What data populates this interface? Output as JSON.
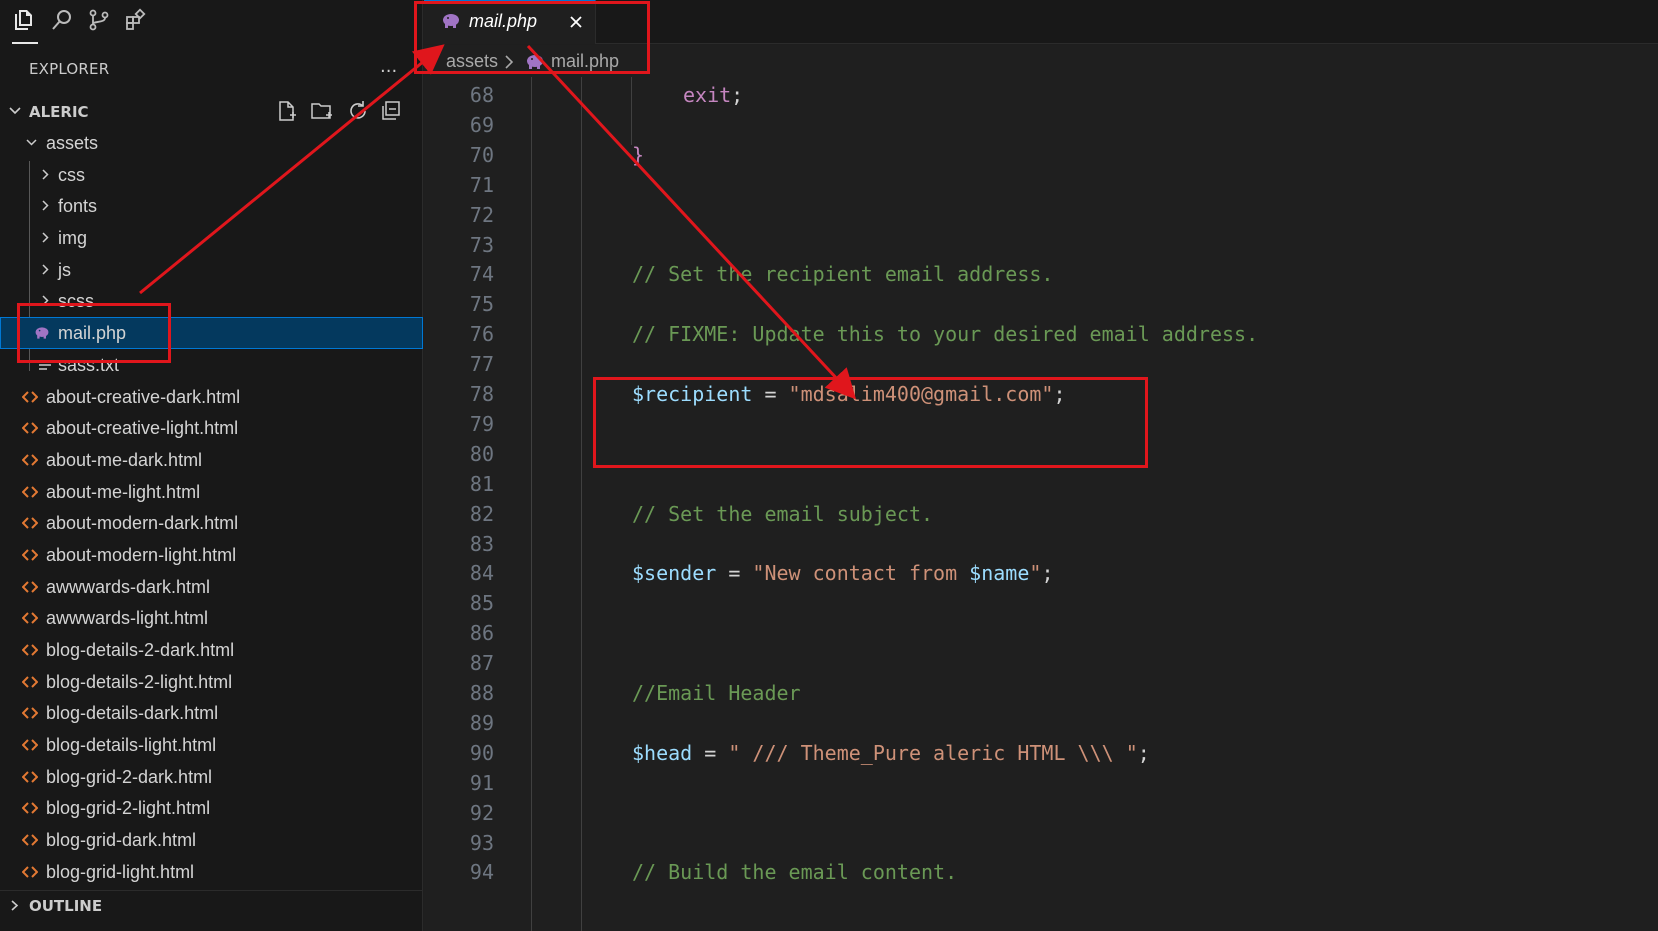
{
  "sidebar": {
    "title": "EXPLORER",
    "more": "...",
    "root": "ALERIC",
    "items": [
      {
        "label": "assets",
        "kind": "folder-open",
        "depth": 1
      },
      {
        "label": "css",
        "kind": "folder",
        "depth": 2
      },
      {
        "label": "fonts",
        "kind": "folder",
        "depth": 2
      },
      {
        "label": "img",
        "kind": "folder",
        "depth": 2
      },
      {
        "label": "js",
        "kind": "folder",
        "depth": 2
      },
      {
        "label": "scss",
        "kind": "folder",
        "depth": 2
      },
      {
        "label": "mail.php",
        "kind": "php",
        "depth": 2,
        "selected": true
      },
      {
        "label": "sass.txt",
        "kind": "txt",
        "depth": 2
      },
      {
        "label": "about-creative-dark.html",
        "kind": "html",
        "depth": 1
      },
      {
        "label": "about-creative-light.html",
        "kind": "html",
        "depth": 1
      },
      {
        "label": "about-me-dark.html",
        "kind": "html",
        "depth": 1
      },
      {
        "label": "about-me-light.html",
        "kind": "html",
        "depth": 1
      },
      {
        "label": "about-modern-dark.html",
        "kind": "html",
        "depth": 1
      },
      {
        "label": "about-modern-light.html",
        "kind": "html",
        "depth": 1
      },
      {
        "label": "awwwards-dark.html",
        "kind": "html",
        "depth": 1
      },
      {
        "label": "awwwards-light.html",
        "kind": "html",
        "depth": 1
      },
      {
        "label": "blog-details-2-dark.html",
        "kind": "html",
        "depth": 1
      },
      {
        "label": "blog-details-2-light.html",
        "kind": "html",
        "depth": 1
      },
      {
        "label": "blog-details-dark.html",
        "kind": "html",
        "depth": 1
      },
      {
        "label": "blog-details-light.html",
        "kind": "html",
        "depth": 1
      },
      {
        "label": "blog-grid-2-dark.html",
        "kind": "html",
        "depth": 1
      },
      {
        "label": "blog-grid-2-light.html",
        "kind": "html",
        "depth": 1
      },
      {
        "label": "blog-grid-dark.html",
        "kind": "html",
        "depth": 1
      },
      {
        "label": "blog-grid-light.html",
        "kind": "html",
        "depth": 1
      }
    ],
    "outline": "OUTLINE"
  },
  "tab": {
    "label": "mail.php",
    "icon": "php-elephant-icon"
  },
  "breadcrumb": {
    "folder": "assets",
    "file": "mail.php"
  },
  "editor": {
    "lines": [
      {
        "n": "68",
        "tokens": [
          {
            "t": "exit",
            "c": "kw"
          },
          {
            "t": ";",
            "c": "op"
          }
        ],
        "indent": 2
      },
      {
        "n": "69",
        "tokens": [],
        "indent": 0
      },
      {
        "n": "70",
        "tokens": [
          {
            "t": "}",
            "c": "kw"
          }
        ],
        "indent": 1
      },
      {
        "n": "71",
        "tokens": [],
        "indent": 0
      },
      {
        "n": "72",
        "tokens": [],
        "indent": 0
      },
      {
        "n": "73",
        "tokens": [],
        "indent": 0
      },
      {
        "n": "74",
        "tokens": [
          {
            "t": "// Set the recipient email address.",
            "c": "cm"
          }
        ],
        "indent": 1
      },
      {
        "n": "75",
        "tokens": [],
        "indent": 0
      },
      {
        "n": "76",
        "tokens": [
          {
            "t": "// FIXME: Update this to your desired email address.",
            "c": "cm"
          }
        ],
        "indent": 1
      },
      {
        "n": "77",
        "tokens": [],
        "indent": 0
      },
      {
        "n": "78",
        "tokens": [
          {
            "t": "$recipient",
            "c": "var"
          },
          {
            "t": " = ",
            "c": "op"
          },
          {
            "t": "\"mdsalim400@gmail.com\"",
            "c": "str"
          },
          {
            "t": ";",
            "c": "op"
          }
        ],
        "indent": 1
      },
      {
        "n": "79",
        "tokens": [],
        "indent": 0
      },
      {
        "n": "80",
        "tokens": [],
        "indent": 0
      },
      {
        "n": "81",
        "tokens": [],
        "indent": 0
      },
      {
        "n": "82",
        "tokens": [
          {
            "t": "// Set the email subject.",
            "c": "cm"
          }
        ],
        "indent": 1
      },
      {
        "n": "83",
        "tokens": [],
        "indent": 0
      },
      {
        "n": "84",
        "tokens": [
          {
            "t": "$sender",
            "c": "var"
          },
          {
            "t": " = ",
            "c": "op"
          },
          {
            "t": "\"New contact from ",
            "c": "str"
          },
          {
            "t": "$name",
            "c": "var"
          },
          {
            "t": "\"",
            "c": "str"
          },
          {
            "t": ";",
            "c": "op"
          }
        ],
        "indent": 1
      },
      {
        "n": "85",
        "tokens": [],
        "indent": 0
      },
      {
        "n": "86",
        "tokens": [],
        "indent": 0
      },
      {
        "n": "87",
        "tokens": [],
        "indent": 0
      },
      {
        "n": "88",
        "tokens": [
          {
            "t": "//Email Header",
            "c": "cm"
          }
        ],
        "indent": 1
      },
      {
        "n": "89",
        "tokens": [],
        "indent": 0
      },
      {
        "n": "90",
        "tokens": [
          {
            "t": "$head",
            "c": "var"
          },
          {
            "t": " = ",
            "c": "op"
          },
          {
            "t": "\" /// Theme_Pure aleric HTML \\\\\\ \"",
            "c": "str"
          },
          {
            "t": ";",
            "c": "op"
          }
        ],
        "indent": 1
      },
      {
        "n": "91",
        "tokens": [],
        "indent": 0
      },
      {
        "n": "92",
        "tokens": [],
        "indent": 0
      },
      {
        "n": "93",
        "tokens": [],
        "indent": 0
      },
      {
        "n": "94",
        "tokens": [
          {
            "t": "// Build the email content.",
            "c": "cm"
          }
        ],
        "indent": 1
      }
    ]
  },
  "colors": {
    "accent": "#0078d4",
    "annotation": "#e0161c",
    "php_icon": "#a074c4",
    "html_icon": "#e37933"
  }
}
